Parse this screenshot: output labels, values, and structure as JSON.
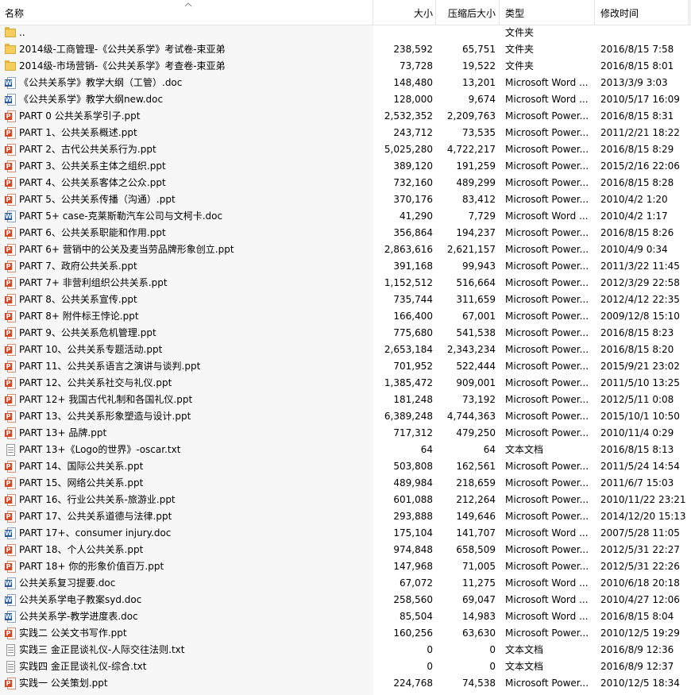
{
  "header": {
    "name": "名称",
    "size": "大小",
    "compressed": "压缩后大小",
    "type": "类型",
    "modified": "修改时间"
  },
  "files": [
    {
      "name": "..",
      "size": "",
      "csize": "",
      "type": "文件夹",
      "date": "",
      "icon": "folder"
    },
    {
      "name": "2014级-工商管理-《公共关系学》考试卷-束亚弟",
      "size": "238,592",
      "csize": "65,751",
      "type": "文件夹",
      "date": "2016/8/15 7:58",
      "icon": "folder"
    },
    {
      "name": "2014级-市场营销-《公共关系学》考查卷-束亚弟",
      "size": "73,728",
      "csize": "19,522",
      "type": "文件夹",
      "date": "2016/8/15 8:01",
      "icon": "folder"
    },
    {
      "name": "《公共关系学》教学大纲（工管）.doc",
      "size": "148,480",
      "csize": "13,201",
      "type": "Microsoft Word ...",
      "date": "2013/3/9 3:03",
      "icon": "word"
    },
    {
      "name": "《公共关系学》教学大纲new.doc",
      "size": "128,000",
      "csize": "9,674",
      "type": "Microsoft Word ...",
      "date": "2010/5/17 16:09",
      "icon": "word"
    },
    {
      "name": "PART 0  公共关系学引子.ppt",
      "size": "2,532,352",
      "csize": "2,209,763",
      "type": "Microsoft Power...",
      "date": "2016/8/15 8:31",
      "icon": "ppt"
    },
    {
      "name": "PART 1、公共关系概述.ppt",
      "size": "243,712",
      "csize": "73,535",
      "type": "Microsoft Power...",
      "date": "2011/2/21 18:22",
      "icon": "ppt"
    },
    {
      "name": "PART 2、古代公共关系行为.ppt",
      "size": "5,025,280",
      "csize": "4,722,217",
      "type": "Microsoft Power...",
      "date": "2016/8/15 8:29",
      "icon": "ppt"
    },
    {
      "name": "PART 3、公共关系主体之组织.ppt",
      "size": "389,120",
      "csize": "191,259",
      "type": "Microsoft Power...",
      "date": "2015/2/16 22:06",
      "icon": "ppt"
    },
    {
      "name": "PART 4、公共关系客体之公众.ppt",
      "size": "732,160",
      "csize": "489,299",
      "type": "Microsoft Power...",
      "date": "2016/8/15 8:28",
      "icon": "ppt"
    },
    {
      "name": "PART 5、公共关系传播（沟通）.ppt",
      "size": "370,176",
      "csize": "83,412",
      "type": "Microsoft Power...",
      "date": "2010/4/2 1:20",
      "icon": "ppt"
    },
    {
      "name": "PART 5+ case-克莱斯勒汽车公司与文柯卡.doc",
      "size": "41,290",
      "csize": "7,729",
      "type": "Microsoft Word ...",
      "date": "2010/4/2 1:17",
      "icon": "word"
    },
    {
      "name": "PART 6、公共关系职能和作用.ppt",
      "size": "356,864",
      "csize": "194,237",
      "type": "Microsoft Power...",
      "date": "2016/8/15 8:26",
      "icon": "ppt"
    },
    {
      "name": "PART 6+ 营销中的公关及麦当劳品牌形象创立.ppt",
      "size": "2,863,616",
      "csize": "2,621,157",
      "type": "Microsoft Power...",
      "date": "2010/4/9 0:34",
      "icon": "ppt"
    },
    {
      "name": "PART 7、政府公共关系.ppt",
      "size": "391,168",
      "csize": "99,943",
      "type": "Microsoft Power...",
      "date": "2011/3/22 11:45",
      "icon": "ppt"
    },
    {
      "name": "PART 7+ 非营利组织公共关系.ppt",
      "size": "1,152,512",
      "csize": "516,664",
      "type": "Microsoft Power...",
      "date": "2012/3/29 22:58",
      "icon": "ppt"
    },
    {
      "name": "PART 8、公共关系宣传.ppt",
      "size": "735,744",
      "csize": "311,659",
      "type": "Microsoft Power...",
      "date": "2012/4/12 22:35",
      "icon": "ppt"
    },
    {
      "name": "PART 8+ 附件标王悖论.ppt",
      "size": "166,400",
      "csize": "67,001",
      "type": "Microsoft Power...",
      "date": "2009/12/8 15:10",
      "icon": "ppt"
    },
    {
      "name": "PART 9、公共关系危机管理.ppt",
      "size": "775,680",
      "csize": "541,538",
      "type": "Microsoft Power...",
      "date": "2016/8/15 8:23",
      "icon": "ppt"
    },
    {
      "name": "PART 10、公共关系专题活动.ppt",
      "size": "2,653,184",
      "csize": "2,343,234",
      "type": "Microsoft Power...",
      "date": "2016/8/15 8:20",
      "icon": "ppt"
    },
    {
      "name": "PART 11、公共关系语言之演讲与谈判.ppt",
      "size": "701,952",
      "csize": "522,444",
      "type": "Microsoft Power...",
      "date": "2015/9/21 23:02",
      "icon": "ppt"
    },
    {
      "name": "PART 12、公共关系社交与礼仪.ppt",
      "size": "1,385,472",
      "csize": "909,001",
      "type": "Microsoft Power...",
      "date": "2011/5/10 13:25",
      "icon": "ppt"
    },
    {
      "name": "PART 12+ 我国古代礼制和各国礼仪.ppt",
      "size": "181,248",
      "csize": "73,192",
      "type": "Microsoft Power...",
      "date": "2012/5/11 0:08",
      "icon": "ppt"
    },
    {
      "name": "PART 13、公共关系形象塑造与设计.ppt",
      "size": "6,389,248",
      "csize": "4,744,363",
      "type": "Microsoft Power...",
      "date": "2015/10/1 10:50",
      "icon": "ppt"
    },
    {
      "name": "PART 13+ 品牌.ppt",
      "size": "717,312",
      "csize": "479,250",
      "type": "Microsoft Power...",
      "date": "2010/11/4 0:29",
      "icon": "ppt"
    },
    {
      "name": "PART 13+《Logo的世界》-oscar.txt",
      "size": "64",
      "csize": "64",
      "type": "文本文档",
      "date": "2016/8/15 8:13",
      "icon": "txt"
    },
    {
      "name": "PART 14、国际公共关系.ppt",
      "size": "503,808",
      "csize": "162,561",
      "type": "Microsoft Power...",
      "date": "2011/5/24 14:54",
      "icon": "ppt"
    },
    {
      "name": "PART 15、网络公共关系.ppt",
      "size": "489,984",
      "csize": "218,659",
      "type": "Microsoft Power...",
      "date": "2011/6/7 15:03",
      "icon": "ppt"
    },
    {
      "name": "PART 16、行业公共关系-旅游业.ppt",
      "size": "601,088",
      "csize": "212,264",
      "type": "Microsoft Power...",
      "date": "2010/11/22 23:21",
      "icon": "ppt"
    },
    {
      "name": "PART 17、公共关系道德与法律.ppt",
      "size": "293,888",
      "csize": "149,646",
      "type": "Microsoft Power...",
      "date": "2014/12/20 15:13",
      "icon": "ppt"
    },
    {
      "name": "PART 17+、consumer injury.doc",
      "size": "175,104",
      "csize": "141,707",
      "type": "Microsoft Word ...",
      "date": "2007/5/28 11:05",
      "icon": "word"
    },
    {
      "name": "PART 18、个人公共关系.ppt",
      "size": "974,848",
      "csize": "658,509",
      "type": "Microsoft Power...",
      "date": "2012/5/31 22:27",
      "icon": "ppt"
    },
    {
      "name": "PART 18+ 你的形象价值百万.ppt",
      "size": "147,968",
      "csize": "71,005",
      "type": "Microsoft Power...",
      "date": "2012/5/31 22:26",
      "icon": "ppt"
    },
    {
      "name": "公共关系复习提要.doc",
      "size": "67,072",
      "csize": "11,275",
      "type": "Microsoft Word ...",
      "date": "2010/6/18 20:18",
      "icon": "word"
    },
    {
      "name": "公共关系学电子教案syd.doc",
      "size": "258,560",
      "csize": "69,047",
      "type": "Microsoft Word ...",
      "date": "2010/4/27 12:06",
      "icon": "word"
    },
    {
      "name": "公共关系学-教学进度表.doc",
      "size": "85,504",
      "csize": "14,983",
      "type": "Microsoft Word ...",
      "date": "2016/8/15 8:04",
      "icon": "word"
    },
    {
      "name": "实践二  公关文书写作.ppt",
      "size": "160,256",
      "csize": "63,630",
      "type": "Microsoft Power...",
      "date": "2010/12/5 19:29",
      "icon": "ppt"
    },
    {
      "name": "实践三 金正昆谈礼仪-人际交往法则.txt",
      "size": "0",
      "csize": "0",
      "type": "文本文档",
      "date": "2016/8/9 12:36",
      "icon": "txt"
    },
    {
      "name": "实践四 金正昆谈礼仪-综合.txt",
      "size": "0",
      "csize": "0",
      "type": "文本文档",
      "date": "2016/8/9 12:37",
      "icon": "txt"
    },
    {
      "name": "实践一 公关策划.ppt",
      "size": "224,768",
      "csize": "74,538",
      "type": "Microsoft Power...",
      "date": "2010/12/5 18:34",
      "icon": "ppt"
    }
  ]
}
